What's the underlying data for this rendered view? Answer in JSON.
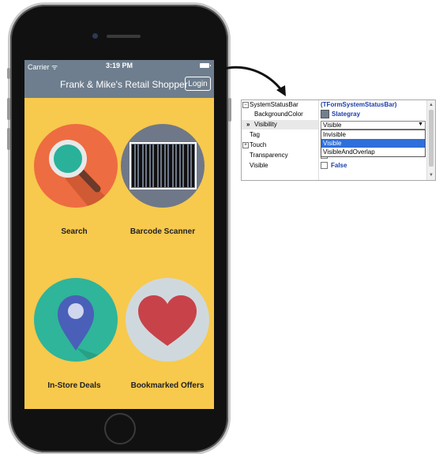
{
  "status_bar": {
    "carrier": "Carrier ᯤ",
    "time": "3:19 PM"
  },
  "nav_bar": {
    "title": "Frank & Mike's Retail Shopper",
    "login_label": "Login"
  },
  "tiles": [
    {
      "label": "Search",
      "icon": "magnifier-icon"
    },
    {
      "label": "Barcode Scanner",
      "icon": "barcode-icon"
    },
    {
      "label": "In-Store Deals",
      "icon": "map-pin-icon"
    },
    {
      "label": "Bookmarked Offers",
      "icon": "heart-icon"
    }
  ],
  "inspector": {
    "rows": [
      {
        "name": "SystemStatusBar",
        "value": "(TFormSystemStatusBar)"
      },
      {
        "name": "BackgroundColor",
        "value": "Slategray"
      },
      {
        "name": "Visibility",
        "value": "Visible",
        "marker": "»"
      },
      {
        "name": "Tag",
        "value": ""
      },
      {
        "name": "Touch",
        "value": ""
      },
      {
        "name": "Transparency",
        "value": "False"
      },
      {
        "name": "Visible",
        "value": "False"
      }
    ],
    "dropdown_options": [
      "Invisible",
      "Visible",
      "VisibleAndOverlap"
    ],
    "selected_option": "Visible"
  },
  "colors": {
    "screen_bg": "#f7c94d",
    "nav_bg": "#6e7e8e",
    "search": "#ee6c41",
    "barcode": "#6f7888",
    "deals": "#2fb59a",
    "bookmark": "#cfd9dd",
    "slategray": "#708090"
  }
}
